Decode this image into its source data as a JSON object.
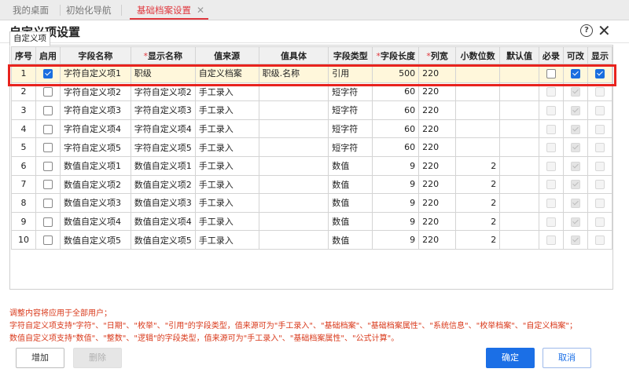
{
  "tabs": [
    {
      "label": "我的桌面"
    },
    {
      "label": "初始化导航"
    },
    {
      "label": "基础档案设置"
    }
  ],
  "dialog": {
    "title": "自定义项设置"
  },
  "subtab": {
    "label": "自定义项"
  },
  "columns": [
    "序号",
    "启用",
    "字段名称",
    "显示名称",
    "值来源",
    "值具体",
    "字段类型",
    "字段长度",
    "列宽",
    "小数位数",
    "默认值",
    "必录",
    "可改",
    "显示"
  ],
  "required_columns": [
    "显示名称",
    "字段长度",
    "列宽"
  ],
  "rows": [
    {
      "no": "1",
      "enabled": true,
      "field": "字符自定义项1",
      "display": "职级",
      "source": "自定义档案",
      "detail": "职级.名称",
      "type": "引用",
      "length": "500",
      "width": "220",
      "decimals": "",
      "default": "",
      "required": false,
      "editable": true,
      "visible": true,
      "selected": true
    },
    {
      "no": "2",
      "enabled": false,
      "field": "字符自定义项2",
      "display": "字符自定义项2",
      "source": "手工录入",
      "detail": "",
      "type": "短字符",
      "length": "60",
      "width": "220",
      "decimals": "",
      "default": "",
      "required": false,
      "editable": true,
      "visible": false
    },
    {
      "no": "3",
      "enabled": false,
      "field": "字符自定义项3",
      "display": "字符自定义项3",
      "source": "手工录入",
      "detail": "",
      "type": "短字符",
      "length": "60",
      "width": "220",
      "decimals": "",
      "default": "",
      "required": false,
      "editable": true,
      "visible": false
    },
    {
      "no": "4",
      "enabled": false,
      "field": "字符自定义项4",
      "display": "字符自定义项4",
      "source": "手工录入",
      "detail": "",
      "type": "短字符",
      "length": "60",
      "width": "220",
      "decimals": "",
      "default": "",
      "required": false,
      "editable": true,
      "visible": false
    },
    {
      "no": "5",
      "enabled": false,
      "field": "字符自定义项5",
      "display": "字符自定义项5",
      "source": "手工录入",
      "detail": "",
      "type": "短字符",
      "length": "60",
      "width": "220",
      "decimals": "",
      "default": "",
      "required": false,
      "editable": true,
      "visible": false
    },
    {
      "no": "6",
      "enabled": false,
      "field": "数值自定义项1",
      "display": "数值自定义项1",
      "source": "手工录入",
      "detail": "",
      "type": "数值",
      "length": "9",
      "width": "220",
      "decimals": "2",
      "default": "",
      "required": false,
      "editable": true,
      "visible": false
    },
    {
      "no": "7",
      "enabled": false,
      "field": "数值自定义项2",
      "display": "数值自定义项2",
      "source": "手工录入",
      "detail": "",
      "type": "数值",
      "length": "9",
      "width": "220",
      "decimals": "2",
      "default": "",
      "required": false,
      "editable": true,
      "visible": false
    },
    {
      "no": "8",
      "enabled": false,
      "field": "数值自定义项3",
      "display": "数值自定义项3",
      "source": "手工录入",
      "detail": "",
      "type": "数值",
      "length": "9",
      "width": "220",
      "decimals": "2",
      "default": "",
      "required": false,
      "editable": true,
      "visible": false
    },
    {
      "no": "9",
      "enabled": false,
      "field": "数值自定义项4",
      "display": "数值自定义项4",
      "source": "手工录入",
      "detail": "",
      "type": "数值",
      "length": "9",
      "width": "220",
      "decimals": "2",
      "default": "",
      "required": false,
      "editable": true,
      "visible": false
    },
    {
      "no": "10",
      "enabled": false,
      "field": "数值自定义项5",
      "display": "数值自定义项5",
      "source": "手工录入",
      "detail": "",
      "type": "数值",
      "length": "9",
      "width": "220",
      "decimals": "2",
      "default": "",
      "required": false,
      "editable": true,
      "visible": false
    }
  ],
  "notes": [
    "调整内容将应用于全部用户；",
    "字符自定义项支持\"字符\"、\"日期\"、\"枚举\"、\"引用\"的字段类型，值来源可为\"手工录入\"、\"基础档案\"、\"基础档案属性\"、\"系统信息\"、\"枚举档案\"、\"自定义档案\"；",
    "数值自定义项支持\"数值\"、\"整数\"、\"逻辑\"的字段类型，值来源可为\"手工录入\"、\"基础档案属性\"、\"公式计算\"。"
  ],
  "buttons": {
    "add": "增加",
    "delete": "删除",
    "ok": "确定",
    "cancel": "取消"
  },
  "colors": {
    "accent": "#1b6fe6",
    "highlight": "#e8231e",
    "note": "#d9391b",
    "active_tab": "#e0383e"
  }
}
